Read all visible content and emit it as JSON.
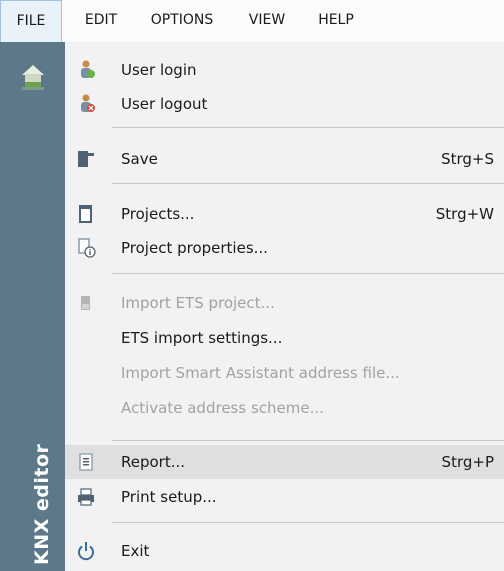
{
  "menubar": {
    "items": [
      {
        "label": "FILE"
      },
      {
        "label": "EDIT"
      },
      {
        "label": "OPTIONS"
      },
      {
        "label": "VIEW"
      },
      {
        "label": "HELP"
      }
    ]
  },
  "sidebar": {
    "brand": "KNX editor",
    "home_icon": "house-icon",
    "color": "#5d7989"
  },
  "file_menu": {
    "items": [
      {
        "label": "User login",
        "shortcut": "",
        "icon": "user-login-icon",
        "enabled": true
      },
      {
        "label": "User logout",
        "shortcut": "",
        "icon": "user-logout-icon",
        "enabled": true
      },
      {
        "label": "Save",
        "shortcut": "Strg+S",
        "icon": "save-icon",
        "enabled": true
      },
      {
        "label": "Projects...",
        "shortcut": "Strg+W",
        "icon": "projects-icon",
        "enabled": true
      },
      {
        "label": "Project properties...",
        "shortcut": "",
        "icon": "project-properties-icon",
        "enabled": true
      },
      {
        "label": "Import ETS project...",
        "shortcut": "",
        "icon": "import-ets-icon",
        "enabled": false
      },
      {
        "label": "ETS import settings...",
        "shortcut": "",
        "icon": "",
        "enabled": true
      },
      {
        "label": "Import Smart Assistant address file...",
        "shortcut": "",
        "icon": "",
        "enabled": false
      },
      {
        "label": "Activate address scheme...",
        "shortcut": "",
        "icon": "",
        "enabled": false
      },
      {
        "label": "Report...",
        "shortcut": "Strg+P",
        "icon": "report-icon",
        "enabled": true,
        "highlighted": true
      },
      {
        "label": "Print setup...",
        "shortcut": "",
        "icon": "printer-icon",
        "enabled": true
      },
      {
        "label": "Exit",
        "shortcut": "",
        "icon": "power-icon",
        "enabled": true
      }
    ]
  },
  "colors": {
    "highlight": "#dfdfdf",
    "disabled_text": "#a2a2a2",
    "active_menu_border": "#9cc3e5"
  }
}
